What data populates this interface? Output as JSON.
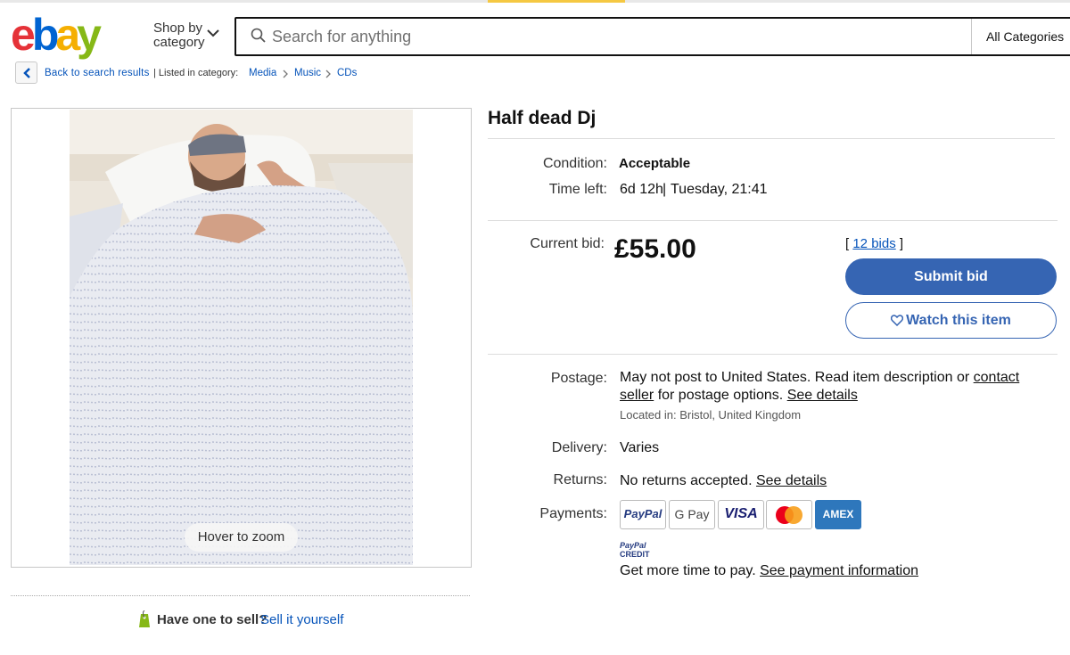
{
  "header": {
    "logo_letters": [
      "e",
      "b",
      "a",
      "y"
    ],
    "shop_by_line1": "Shop by",
    "shop_by_line2": "category",
    "search_placeholder": "Search for anything",
    "all_categories": "All Categories"
  },
  "breadcrumb": {
    "back_label": "Back to search results",
    "listed_label": "| Listed in category:",
    "items": [
      "Media",
      "Music",
      "CDs"
    ]
  },
  "image": {
    "zoom_label": "Hover to zoom"
  },
  "sell": {
    "prompt": "Have one to sell?",
    "link": "Sell it yourself"
  },
  "listing": {
    "title": "Half dead Dj",
    "condition_label": "Condition:",
    "condition_value": "Acceptable",
    "time_left_label": "Time left:",
    "time_left_value": "6d 12h",
    "time_left_sep": "|",
    "time_left_end": "Tuesday, 21:41",
    "current_bid_label": "Current bid:",
    "current_bid_value": "£55.00",
    "bids_open": "[",
    "bids_link": "12 bids",
    "bids_close": "]",
    "submit_bid": "Submit bid",
    "watch_item": "Watch this item"
  },
  "postage": {
    "label": "Postage:",
    "text1": "May not post to United States. Read item description or",
    "contact_link": "contact seller",
    "text2": "for postage options.",
    "see_details": "See details",
    "located": "Located in: Bristol, United Kingdom"
  },
  "delivery": {
    "label": "Delivery:",
    "value": "Varies"
  },
  "returns": {
    "label": "Returns:",
    "value": "No returns accepted.",
    "see_details": "See details"
  },
  "payments": {
    "label": "Payments:",
    "methods": [
      "PayPal",
      "G Pay",
      "VISA",
      "Mastercard",
      "AMEX"
    ],
    "credit_line1": "PayPal",
    "credit_line2": "CREDIT",
    "more_time": "Get more time to pay.",
    "payment_info_link": "See payment information"
  },
  "colors": {
    "link": "#0654ba",
    "button": "#3665b3",
    "ebay_red": "#e53238",
    "ebay_blue": "#0064d2",
    "ebay_yellow": "#f5af02",
    "ebay_green": "#86b817"
  }
}
